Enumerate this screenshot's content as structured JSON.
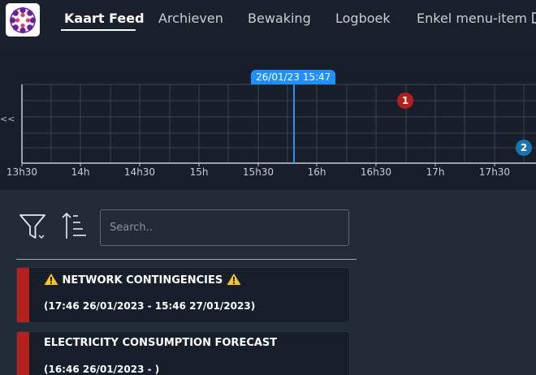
{
  "nav": {
    "logo_icon": "flower-logo",
    "items": [
      {
        "label": "Kaart Feed",
        "active": true
      },
      {
        "label": "Archieven",
        "active": false
      },
      {
        "label": "Bewaking",
        "active": false
      },
      {
        "label": "Logboek",
        "active": false
      },
      {
        "label": "Enkel menu-item",
        "active": false,
        "icon": "external-link-icon"
      }
    ]
  },
  "timeline": {
    "current_time": "26/01/23 15:47",
    "nav_left": "<<",
    "ticks": [
      "13h30",
      "14h",
      "14h30",
      "15h",
      "15h30",
      "16h",
      "16h30",
      "17h",
      "17h30"
    ],
    "markers": [
      {
        "label": "1",
        "color": "#b3211f"
      },
      {
        "label": "2",
        "color": "#1c74b3"
      }
    ]
  },
  "filters": {
    "filter_icon": "filter-icon",
    "sort_icon": "sort-ascending-icon",
    "search_placeholder": "Search.."
  },
  "cards": [
    {
      "title": "NETWORK CONTINGENCIES",
      "icon": "warning-icon",
      "dates": "(17:46 26/01/2023 - 15:46 27/01/2023)",
      "severity_color": "#b3211f"
    },
    {
      "title": "ELECTRICITY CONSUMPTION FORECAST",
      "dates": "(16:46 26/01/2023 - )",
      "severity_color": "#b3211f"
    }
  ],
  "colors": {
    "accent": "#1e90ff",
    "alarm": "#b3211f",
    "info": "#1c74b3"
  }
}
